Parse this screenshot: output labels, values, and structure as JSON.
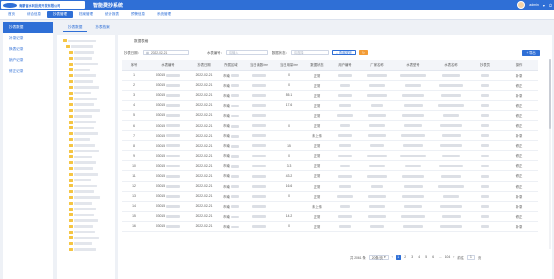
{
  "header": {
    "logo_text": "海蒙省水利投资开发有限公司",
    "app_title": "智能费抄系统",
    "user_name": "admin"
  },
  "topnav": {
    "items": [
      {
        "label": "首页"
      },
      {
        "label": "综合信息"
      },
      {
        "label": "抄表管理"
      },
      {
        "label": "档案管理"
      },
      {
        "label": "统计报表"
      },
      {
        "label": "预警信息"
      },
      {
        "label": "系统管理"
      }
    ],
    "active_index": 2
  },
  "sidebar": {
    "items": [
      {
        "label": "抄表数据"
      },
      {
        "label": "补录记录"
      },
      {
        "label": "换表记录"
      },
      {
        "label": "销户记录"
      },
      {
        "label": "修正记录"
      }
    ],
    "active_index": 0
  },
  "tabs": {
    "items": [
      {
        "label": "抄表数据"
      },
      {
        "label": "抄表档案"
      }
    ],
    "active_index": 0
  },
  "main": {
    "title": "数据表格",
    "filters": {
      "date_label": "抄表日期：",
      "date_value": "2022-02-21",
      "meter_label": "水表编号：",
      "meter_placeholder": "请输入",
      "status_label": "数据状态：",
      "status_placeholder": "请选择",
      "query_label": "查询按钮",
      "reset_icon": "refresh-icon",
      "add_label": "+ 导出"
    },
    "table": {
      "headers": [
        "序号",
        "水表编号",
        "抄表日期",
        "所属区域",
        "当日读数/m³",
        "当日用量/m³",
        "数据状态",
        "用户编号",
        "厂家名称",
        "水表型号",
        "水表名称",
        "抄表员",
        "操作"
      ],
      "rows": [
        {
          "no": "1",
          "code": "03015",
          "date": "2022-02-21",
          "region": "市南",
          "reading": "",
          "usage": "0",
          "status": "正常",
          "op": "补录"
        },
        {
          "no": "2",
          "code": "03015",
          "date": "2022-02-21",
          "region": "市南",
          "reading": "",
          "usage": "0",
          "status": "正常",
          "op": "修正"
        },
        {
          "no": "3",
          "code": "03015",
          "date": "2022-02-21",
          "region": "市南",
          "reading": "",
          "usage": "55.1",
          "status": "正常",
          "op": "补录"
        },
        {
          "no": "4",
          "code": "03015",
          "date": "2022-02-21",
          "region": "市南",
          "reading": "",
          "usage": "17.6",
          "status": "正常",
          "op": "修正"
        },
        {
          "no": "5",
          "code": "03015",
          "date": "2022-02-21",
          "region": "市南",
          "reading": "",
          "usage": "",
          "status": "正常",
          "op": "修正"
        },
        {
          "no": "6",
          "code": "03015",
          "date": "2022-02-21",
          "region": "市南",
          "reading": "",
          "usage": "0",
          "status": "正常",
          "op": "修正"
        },
        {
          "no": "7",
          "code": "03015",
          "date": "2022-02-21",
          "region": "市南",
          "reading": "",
          "usage": "",
          "status": "未上传",
          "op": "补录"
        },
        {
          "no": "8",
          "code": "03015",
          "date": "2022-02-21",
          "region": "市南",
          "reading": "",
          "usage": "15",
          "status": "正常",
          "op": "修正"
        },
        {
          "no": "9",
          "code": "03015",
          "date": "2022-02-21",
          "region": "市南",
          "reading": "",
          "usage": "0",
          "status": "正常",
          "op": "修正"
        },
        {
          "no": "10",
          "code": "03015",
          "date": "2022-02-21",
          "region": "市南",
          "reading": "",
          "usage": "3.3",
          "status": "正常",
          "op": "修正"
        },
        {
          "no": "11",
          "code": "03015",
          "date": "2022-02-21",
          "region": "市南",
          "reading": "",
          "usage": "43.2",
          "status": "正常",
          "op": "修正"
        },
        {
          "no": "12",
          "code": "03015",
          "date": "2022-02-21",
          "region": "市南",
          "reading": "",
          "usage": "16.6",
          "status": "正常",
          "op": "修正"
        },
        {
          "no": "13",
          "code": "03015",
          "date": "2022-02-21",
          "region": "市南",
          "reading": "",
          "usage": "0",
          "status": "正常",
          "op": "补录"
        },
        {
          "no": "14",
          "code": "03015",
          "date": "2022-02-21",
          "region": "市南",
          "reading": "",
          "usage": "",
          "status": "未上传",
          "op": "补录"
        },
        {
          "no": "15",
          "code": "03015",
          "date": "2022-02-21",
          "region": "市南",
          "reading": "",
          "usage": "14.2",
          "status": "正常",
          "op": "修正"
        },
        {
          "no": "16",
          "code": "03015",
          "date": "2022-02-21",
          "region": "市南",
          "reading": "",
          "usage": "0",
          "status": "正常",
          "op": "补录"
        }
      ]
    },
    "pager": {
      "total": "共 2061 条",
      "page_size": "20条/页",
      "pages": [
        "1",
        "2",
        "3",
        "4",
        "5",
        "6",
        "...",
        "104"
      ],
      "active_page": "1",
      "goto_label": "前往",
      "goto_value": "1",
      "page_unit": "页"
    }
  },
  "colors": {
    "primary": "#2f6fd6",
    "warn": "#f39c35"
  }
}
